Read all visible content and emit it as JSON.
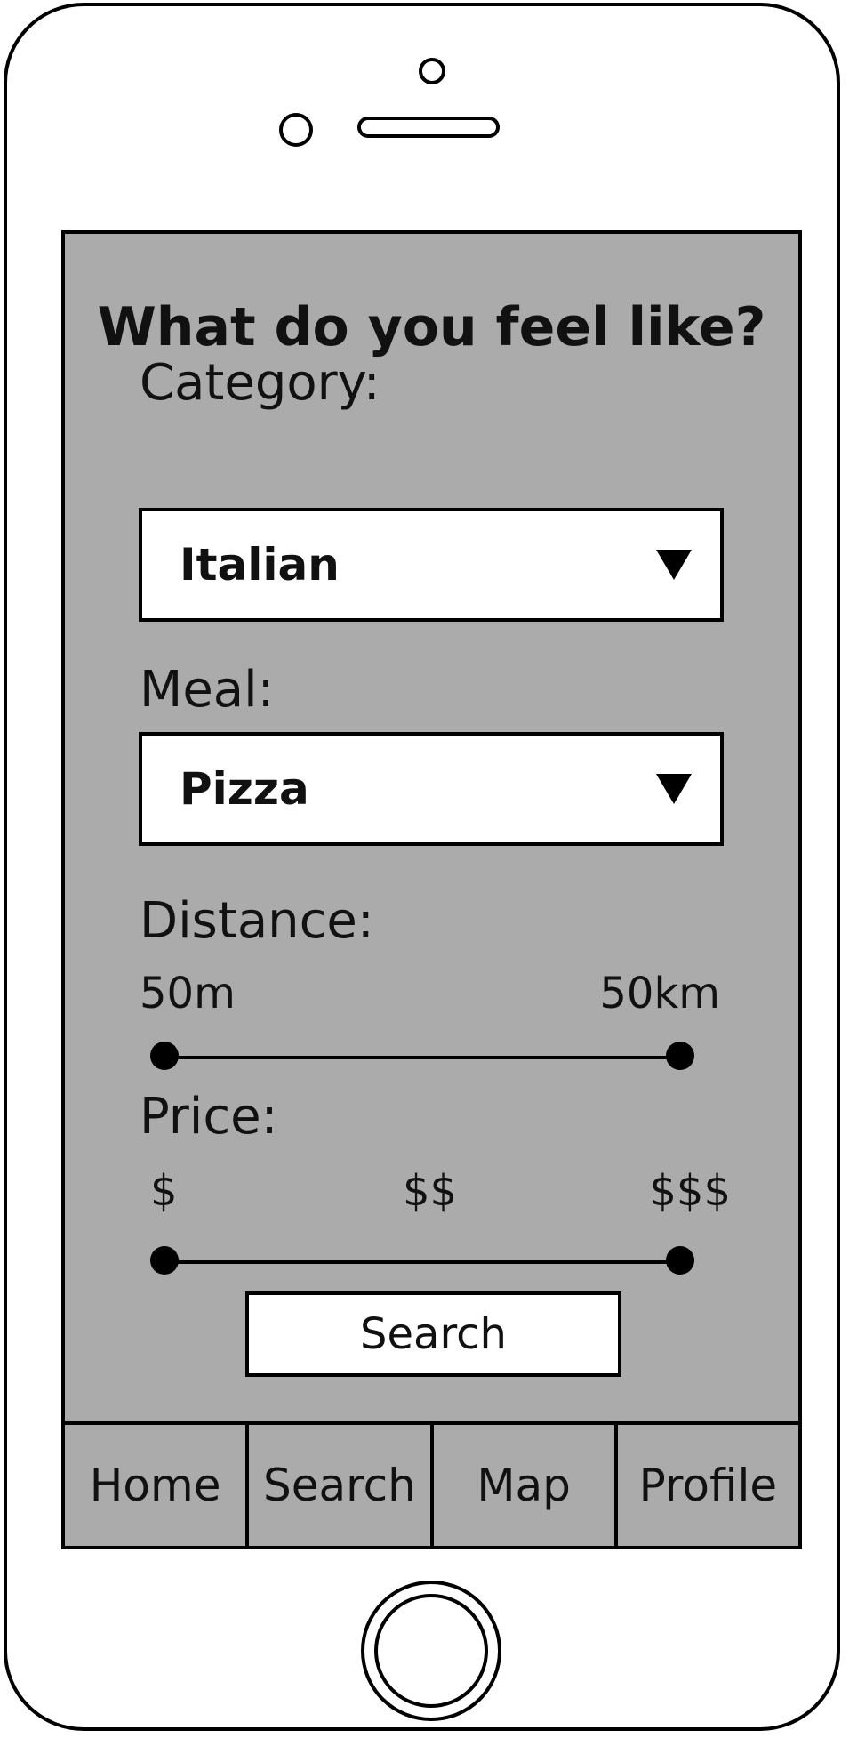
{
  "screen": {
    "title": "What do you feel like?",
    "category": {
      "label": "Category:",
      "selected": "Italian"
    },
    "meal": {
      "label": "Meal:",
      "selected": "Pizza"
    },
    "distance": {
      "label": "Distance:",
      "min_label": "50m",
      "max_label": "50km"
    },
    "price": {
      "label": "Price:",
      "low_label": "$",
      "mid_label": "$$",
      "high_label": "$$$"
    },
    "search_button": "Search"
  },
  "tabbar": {
    "tabs": [
      {
        "label": "Home"
      },
      {
        "label": "Search"
      },
      {
        "label": "Map"
      },
      {
        "label": "Profile"
      }
    ]
  }
}
